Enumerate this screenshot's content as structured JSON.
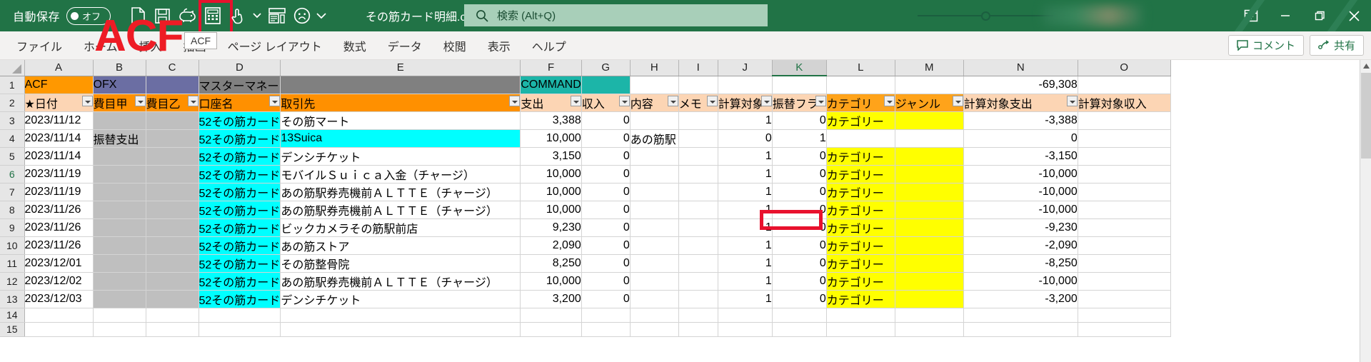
{
  "titlebar": {
    "autosave_label": "自動保存",
    "autosave_state": "オフ",
    "document_title": "その筋カード明細.csv",
    "qat": [
      {
        "name": "new-file-icon",
        "label": "新規"
      },
      {
        "name": "save-icon",
        "label": "保存"
      },
      {
        "name": "piggy-bank-icon",
        "label": "貯金"
      },
      {
        "name": "calculator-icon",
        "label": "ACF"
      },
      {
        "name": "touch-mode-icon",
        "label": "タッチ/マウス モードの切り替え"
      },
      {
        "name": "chevron-down-icon",
        "label": "クイック アクセス ツール バーのユーザー設定"
      },
      {
        "name": "form-icon",
        "label": "フォーム"
      },
      {
        "name": "feedback-frown-icon",
        "label": "フィードバック"
      },
      {
        "name": "ribbon-display-caret-icon",
        "label": "リボンの表示オプション"
      }
    ],
    "search_placeholder": "検索 (Alt+Q)",
    "window_buttons": [
      {
        "name": "ribbon-display-options-button",
        "glyph": "⊼"
      },
      {
        "name": "minimize-button",
        "glyph": "—"
      },
      {
        "name": "restore-button",
        "glyph": "❐"
      },
      {
        "name": "close-button",
        "glyph": "✕"
      }
    ]
  },
  "ribbon": {
    "tabs": [
      "ファイル",
      "ホーム",
      "挿入",
      "描画",
      "ページ レイアウト",
      "数式",
      "データ",
      "校閲",
      "表示",
      "ヘルプ"
    ],
    "comment_label": "コメント",
    "share_label": "共有"
  },
  "overlay": {
    "watermark_text": "ACF",
    "watermark_color": "#ee1c25",
    "tooltip_text": "ACF",
    "annotation_color": "#e8112d"
  },
  "grid": {
    "columns": [
      "A",
      "B",
      "C",
      "D",
      "E",
      "F",
      "G",
      "H",
      "I",
      "J",
      "K",
      "L",
      "M",
      "N",
      "O"
    ],
    "selected_column": "K",
    "row_numbers": [
      "1",
      "2",
      "3",
      "4",
      "5",
      "6",
      "7",
      "8",
      "9",
      "10",
      "11",
      "12",
      "13",
      "14",
      "15"
    ],
    "selected_row": "6",
    "row1": {
      "A": "ACF",
      "B": "OFX",
      "D": "マスターマネー",
      "F": "COMMAND",
      "N": "-69,308"
    },
    "headers": {
      "A": "★日付",
      "B": "費目甲",
      "C": "費目乙",
      "D": "口座名",
      "E": "取引先",
      "F": "支出",
      "G": "収入",
      "H": "内容",
      "I": "メモ",
      "J": "計算対象",
      "K": "振替フラ",
      "L": "カテゴリ",
      "M": "ジャンル",
      "N": "計算対象支出",
      "O": "計算対象収入"
    },
    "rows": [
      {
        "n": "3",
        "date": "2023/11/12",
        "hi": "",
        "otsu": "",
        "account": "52その筋カード",
        "payee": "その筋マート",
        "expense": "3,388",
        "income": "0",
        "naiyo": "",
        "memo": "",
        "calc": "1",
        "furikae": "0",
        "category": "カテゴリー",
        "genre": "",
        "calc_expense": "-3,388",
        "calc_income": ""
      },
      {
        "n": "4",
        "date": "2023/11/14",
        "hi": "振替支出",
        "otsu": "",
        "account": "52その筋カード",
        "payee": "13Suica",
        "expense": "10,000",
        "income": "0",
        "naiyo": "あの筋駅",
        "memo": "",
        "calc": "0",
        "furikae": "1",
        "category": "",
        "genre": "",
        "calc_expense": "0",
        "calc_income": ""
      },
      {
        "n": "5",
        "date": "2023/11/14",
        "hi": "",
        "otsu": "",
        "account": "52その筋カード",
        "payee": "デンシチケット",
        "expense": "3,150",
        "income": "0",
        "naiyo": "",
        "memo": "",
        "calc": "1",
        "furikae": "0",
        "category": "カテゴリー",
        "genre": "",
        "calc_expense": "-3,150",
        "calc_income": ""
      },
      {
        "n": "6",
        "date": "2023/11/19",
        "hi": "",
        "otsu": "",
        "account": "52その筋カード",
        "payee": "モバイルＳｕｉｃａ入金（チャージ）",
        "expense": "10,000",
        "income": "0",
        "naiyo": "",
        "memo": "",
        "calc": "1",
        "furikae": "0",
        "category": "カテゴリー",
        "genre": "",
        "calc_expense": "-10,000",
        "calc_income": ""
      },
      {
        "n": "7",
        "date": "2023/11/19",
        "hi": "",
        "otsu": "",
        "account": "52その筋カード",
        "payee": "あの筋駅券売機前ＡＬＴＴＥ（チャージ）",
        "expense": "10,000",
        "income": "0",
        "naiyo": "",
        "memo": "",
        "calc": "1",
        "furikae": "0",
        "category": "カテゴリー",
        "genre": "",
        "calc_expense": "-10,000",
        "calc_income": ""
      },
      {
        "n": "8",
        "date": "2023/11/26",
        "hi": "",
        "otsu": "",
        "account": "52その筋カード",
        "payee": "あの筋駅券売機前ＡＬＴＴＥ（チャージ）",
        "expense": "10,000",
        "income": "0",
        "naiyo": "",
        "memo": "",
        "calc": "1",
        "furikae": "0",
        "category": "カテゴリー",
        "genre": "",
        "calc_expense": "-10,000",
        "calc_income": ""
      },
      {
        "n": "9",
        "date": "2023/11/26",
        "hi": "",
        "otsu": "",
        "account": "52その筋カード",
        "payee": "ビックカメラその筋駅前店",
        "expense": "9,230",
        "income": "0",
        "naiyo": "",
        "memo": "",
        "calc": "1",
        "furikae": "0",
        "category": "カテゴリー",
        "genre": "",
        "calc_expense": "-9,230",
        "calc_income": ""
      },
      {
        "n": "10",
        "date": "2023/11/26",
        "hi": "",
        "otsu": "",
        "account": "52その筋カード",
        "payee": "あの筋ストア",
        "expense": "2,090",
        "income": "0",
        "naiyo": "",
        "memo": "",
        "calc": "1",
        "furikae": "0",
        "category": "カテゴリー",
        "genre": "",
        "calc_expense": "-2,090",
        "calc_income": ""
      },
      {
        "n": "11",
        "date": "2023/12/01",
        "hi": "",
        "otsu": "",
        "account": "52その筋カード",
        "payee": "その筋整骨院",
        "expense": "8,250",
        "income": "0",
        "naiyo": "",
        "memo": "",
        "calc": "1",
        "furikae": "0",
        "category": "カテゴリー",
        "genre": "",
        "calc_expense": "-8,250",
        "calc_income": ""
      },
      {
        "n": "12",
        "date": "2023/12/02",
        "hi": "",
        "otsu": "",
        "account": "52その筋カード",
        "payee": "あの筋駅券売機前ＡＬＴＴＥ（チャージ）",
        "expense": "10,000",
        "income": "0",
        "naiyo": "",
        "memo": "",
        "calc": "1",
        "furikae": "0",
        "category": "カテゴリー",
        "genre": "",
        "calc_expense": "-10,000",
        "calc_income": ""
      },
      {
        "n": "13",
        "date": "2023/12/03",
        "hi": "",
        "otsu": "",
        "account": "52その筋カード",
        "payee": "デンシチケット",
        "expense": "3,200",
        "income": "0",
        "naiyo": "",
        "memo": "",
        "calc": "1",
        "furikae": "0",
        "category": "カテゴリー",
        "genre": "",
        "calc_expense": "-3,200",
        "calc_income": ""
      }
    ],
    "empty_rows": [
      "14",
      "15"
    ],
    "colors": {
      "acf_fill": "#ff9800",
      "ofx_fill": "#6b6ea3",
      "mastermoney_fill": "#808080",
      "command_fill": "#1cb5a8",
      "header_peach": "#fcd5b4",
      "header_orange": "#ff9000",
      "category_orange": "#ffa31a",
      "cyan_fill": "#00ffff",
      "gray_fill": "#bfbfbf",
      "yellow_fill": "#ffff00"
    }
  }
}
